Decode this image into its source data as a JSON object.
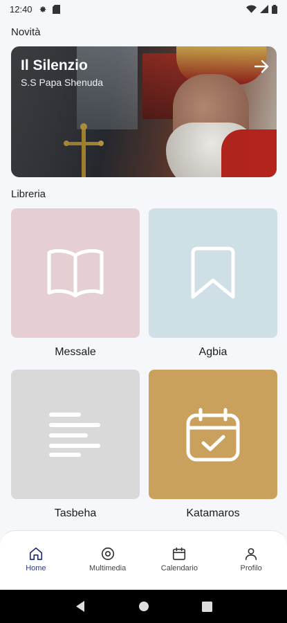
{
  "status_bar": {
    "time": "12:40"
  },
  "news": {
    "section_title": "Novità",
    "hero": {
      "title": "Il Silenzio",
      "subtitle": "S.S Papa Shenuda"
    }
  },
  "library": {
    "section_title": "Libreria",
    "tiles": [
      {
        "label": "Messale",
        "icon": "open-book-icon",
        "color": "#e6cfd3"
      },
      {
        "label": "Agbia",
        "icon": "bookmark-icon",
        "color": "#cfdfe6"
      },
      {
        "label": "Tasbeha",
        "icon": "text-lines-icon",
        "color": "#d9d9d9"
      },
      {
        "label": "Katamaros",
        "icon": "calendar-check-icon",
        "color": "#c9a15c"
      }
    ]
  },
  "bottom_nav": {
    "items": [
      {
        "label": "Home",
        "icon": "home-icon",
        "active": true
      },
      {
        "label": "Multimedia",
        "icon": "disc-icon",
        "active": false
      },
      {
        "label": "Calendario",
        "icon": "calendar-icon",
        "active": false
      },
      {
        "label": "Profilo",
        "icon": "user-icon",
        "active": false
      }
    ]
  },
  "colors": {
    "accent": "#2a3a8c",
    "background": "#f6f7fb"
  }
}
